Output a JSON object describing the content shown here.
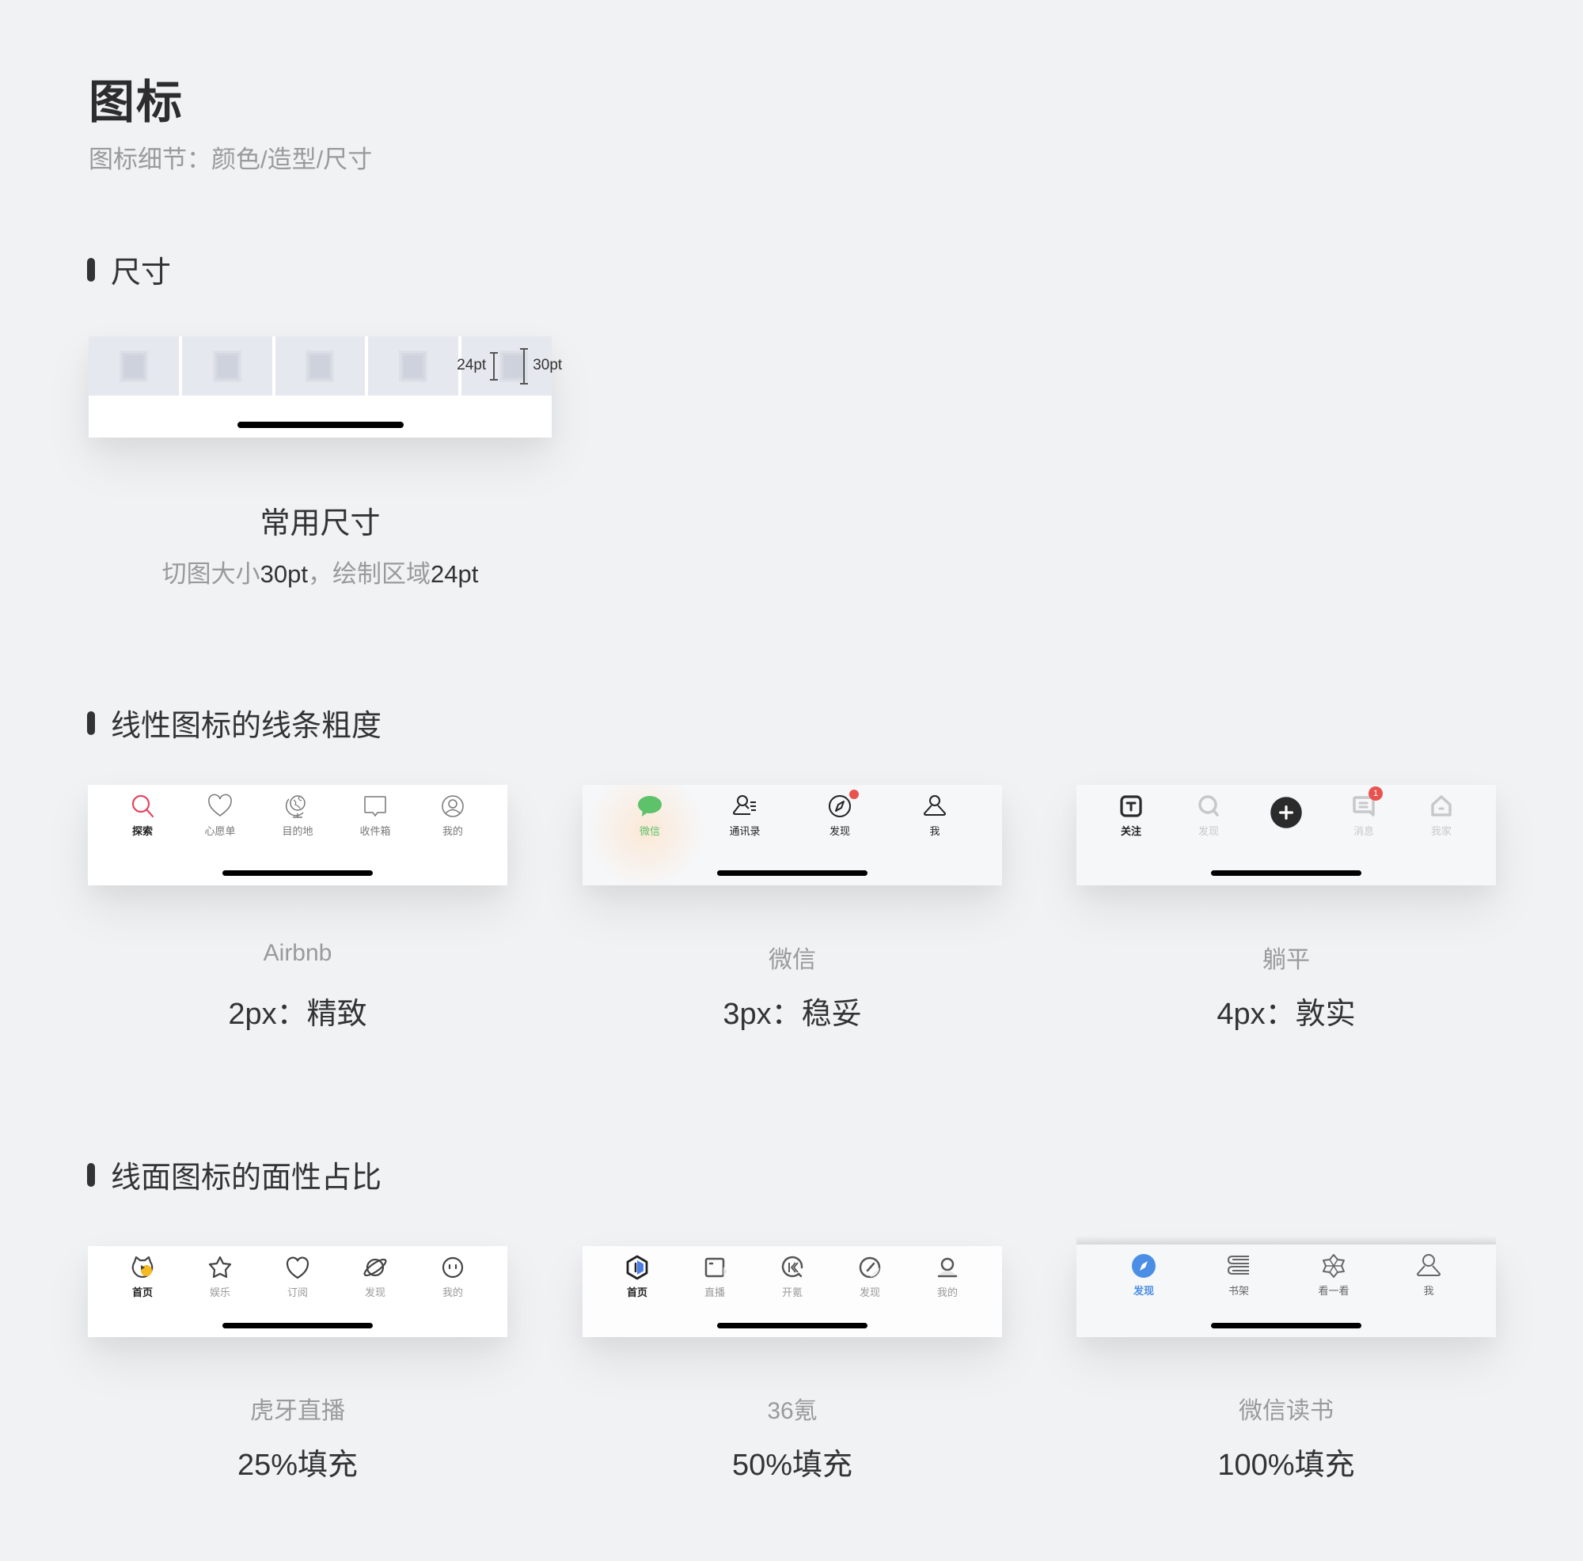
{
  "header": {
    "title": "图标",
    "subtitle": "图标细节：颜色/造型/尺寸"
  },
  "sections": {
    "size": {
      "heading": "尺寸",
      "card": {
        "cell_count": 5,
        "inner_label": "24pt",
        "outer_label": "30pt"
      },
      "title": "常用尺寸",
      "subtitle_parts": [
        "切图大小",
        "30pt",
        "，绘制区域",
        "24pt"
      ]
    },
    "line_weight": {
      "heading": "线性图标的线条粗度",
      "cards": [
        {
          "app": "Airbnb",
          "caption": "2px：精致",
          "tabs": [
            {
              "label": "探索",
              "icon": "search-icon",
              "active": true
            },
            {
              "label": "心愿单",
              "icon": "heart-icon",
              "active": false
            },
            {
              "label": "目的地",
              "icon": "globe-icon",
              "active": false
            },
            {
              "label": "收件箱",
              "icon": "message-icon",
              "active": false
            },
            {
              "label": "我的",
              "icon": "user-circle-icon",
              "active": false
            }
          ],
          "colors": {
            "accent": "#e0485f",
            "active_label": "#222222",
            "inactive": "#777777"
          }
        },
        {
          "app": "微信",
          "caption": "3px：稳妥",
          "tabs": [
            {
              "label": "微信",
              "icon": "chat-bubble-icon",
              "active": true
            },
            {
              "label": "通讯录",
              "icon": "contacts-icon",
              "active": false
            },
            {
              "label": "发现",
              "icon": "compass-icon",
              "active": false,
              "badge": "dot"
            },
            {
              "label": "我",
              "icon": "user-icon",
              "active": false
            }
          ],
          "colors": {
            "accent": "#5dc26a",
            "inactive": "#222222",
            "badge": "#e9534f"
          }
        },
        {
          "app": "躺平",
          "caption": "4px：敦实",
          "tabs": [
            {
              "label": "关注",
              "icon": "follow-square-icon",
              "active": true
            },
            {
              "label": "发现",
              "icon": "search-icon",
              "active": false
            },
            {
              "label": "",
              "icon": "plus-circle-icon",
              "active": false
            },
            {
              "label": "消息",
              "icon": "message-icon",
              "active": false,
              "badge": "1"
            },
            {
              "label": "我家",
              "icon": "home-icon",
              "active": false
            }
          ],
          "colors": {
            "accent": "#2b2b2b",
            "inactive": "#c8c8ca",
            "badge": "#e9534f"
          }
        }
      ]
    },
    "fill_ratio": {
      "heading": "线面图标的面性占比",
      "cards": [
        {
          "app": "虎牙直播",
          "caption": "25%填充",
          "tabs": [
            {
              "label": "首页",
              "icon": "huya-home-icon",
              "active": true
            },
            {
              "label": "娱乐",
              "icon": "star-icon",
              "active": false
            },
            {
              "label": "订阅",
              "icon": "heart-icon",
              "active": false
            },
            {
              "label": "发现",
              "icon": "planet-icon",
              "active": false
            },
            {
              "label": "我的",
              "icon": "face-icon",
              "active": false
            }
          ],
          "colors": {
            "accent": "#f5b921",
            "active_label": "#222222",
            "inactive": "#999999"
          }
        },
        {
          "app": "36氪",
          "caption": "50%填充",
          "tabs": [
            {
              "label": "首页",
              "icon": "hexagon-icon",
              "active": true
            },
            {
              "label": "直播",
              "icon": "live-square-icon",
              "active": false
            },
            {
              "label": "开氪",
              "icon": "kr-bubble-icon",
              "active": false
            },
            {
              "label": "发现",
              "icon": "gauge-icon",
              "active": false
            },
            {
              "label": "我的",
              "icon": "user-bust-icon",
              "active": false
            }
          ],
          "colors": {
            "accent": "#4a7fe8",
            "active_label": "#222222",
            "inactive": "#999999"
          }
        },
        {
          "app": "微信读书",
          "caption": "100%填充",
          "tabs": [
            {
              "label": "发现",
              "icon": "compass-filled-icon",
              "active": true
            },
            {
              "label": "书架",
              "icon": "bookshelf-icon",
              "active": false
            },
            {
              "label": "看一看",
              "icon": "hexagram-icon",
              "active": false
            },
            {
              "label": "我",
              "icon": "user-icon",
              "active": false
            }
          ],
          "colors": {
            "accent": "#4a8ee6",
            "inactive": "#666666"
          }
        }
      ]
    }
  }
}
